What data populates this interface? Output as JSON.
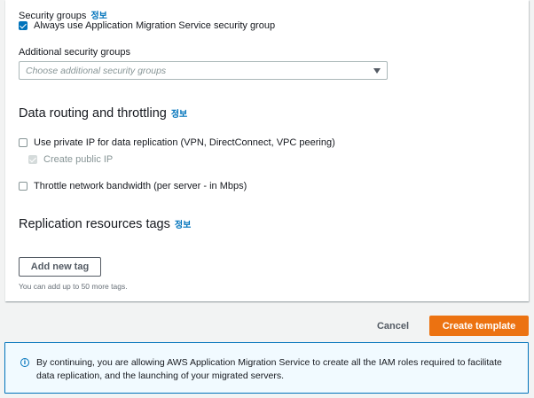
{
  "security": {
    "title": "Security groups",
    "info": "정보",
    "checkbox_label": "Always use Application Migration Service security group",
    "additional_label": "Additional security groups",
    "additional_placeholder": "Choose additional security groups"
  },
  "routing": {
    "title": "Data routing and throttling",
    "info": "정보",
    "private_ip_label": "Use private IP for data replication (VPN, DirectConnect, VPC peering)",
    "public_ip_label": "Create public IP",
    "throttle_label": "Throttle network bandwidth (per server - in Mbps)"
  },
  "tags": {
    "title": "Replication resources tags",
    "info": "정보",
    "add_button": "Add new tag",
    "hint": "You can add up to 50 more tags."
  },
  "footer": {
    "cancel": "Cancel",
    "create": "Create template"
  },
  "alert": {
    "icon": "info-icon",
    "text": "By continuing, you are allowing AWS Application Migration Service to create all the IAM roles required to facilitate data replication, and the launching of your migrated servers."
  },
  "colors": {
    "primary": "#ec7211",
    "link": "#0073bb",
    "alert_bg": "#f1faff"
  }
}
